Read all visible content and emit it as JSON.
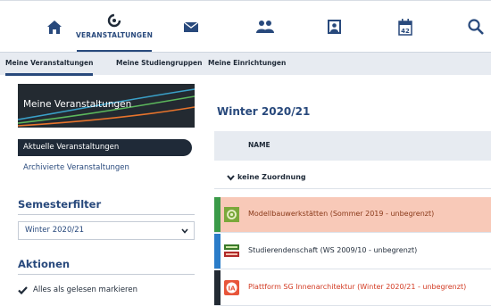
{
  "nav": {
    "items": [
      {
        "name": "home",
        "icon": "home-icon",
        "label": ""
      },
      {
        "name": "veranstaltungen",
        "icon": "courses-icon",
        "label": "VERANSTALTUNGEN"
      },
      {
        "name": "messages",
        "icon": "mail-icon",
        "label": ""
      },
      {
        "name": "community",
        "icon": "people-icon",
        "label": ""
      },
      {
        "name": "profile",
        "icon": "profile-icon",
        "label": ""
      },
      {
        "name": "planner",
        "icon": "calendar-icon",
        "label": ""
      },
      {
        "name": "search",
        "icon": "search-icon",
        "label": ""
      }
    ],
    "calendar_day": "42",
    "active": "veranstaltungen"
  },
  "subnav": {
    "tabs": [
      {
        "label": "Meine Veranstaltungen",
        "active": true
      },
      {
        "label": "Meine Studiengruppen",
        "active": false
      },
      {
        "label": "Meine Einrichtungen",
        "active": false
      }
    ]
  },
  "sidebar": {
    "banner_title": "Meine Veranstaltungen",
    "views": [
      {
        "label": "Aktuelle Veranstaltungen",
        "active": true
      },
      {
        "label": "Archivierte Veranstaltungen",
        "active": false
      }
    ],
    "semesterfilter": {
      "title": "Semesterfilter",
      "selected": "Winter 2020/21"
    },
    "aktionen": {
      "title": "Aktionen",
      "items": [
        "Alles als gelesen markieren"
      ]
    }
  },
  "main": {
    "title": "Winter 2020/21",
    "column_header": "NAME",
    "group_label": "keine Zuordnung",
    "rows": [
      {
        "label": "Modellbauwerkstätten (Sommer 2019 - unbegrenzt)",
        "text_color": "#8a3a1a",
        "bar_color": "#3a9a48",
        "bg": "#f8c9b8"
      },
      {
        "label": "Studierendenschaft (WS 2009/10 - unbegrenzt)",
        "text_color": "#1f2a38",
        "bar_color": "#2a7cc8",
        "bg": "#ffffff"
      },
      {
        "label": "Plattform SG Innenarchitektur (Winter 2020/21 - unbegrenzt)",
        "text_color": "#d23a22",
        "bar_color": "#222a33",
        "bg": "#ffffff",
        "icon_text": "IA"
      }
    ]
  },
  "colors": {
    "primary": "#28497c",
    "dark": "#1f2a38",
    "highlight": "#f8c9b8"
  }
}
